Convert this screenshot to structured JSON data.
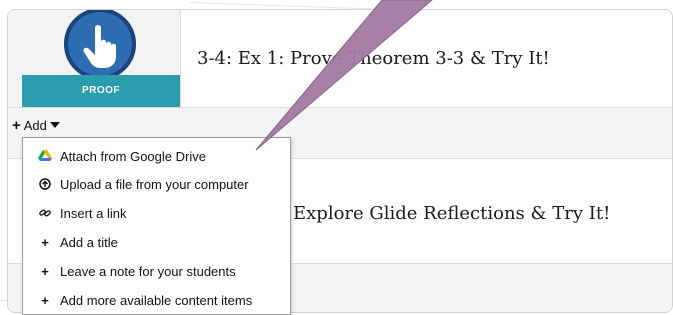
{
  "lesson1": {
    "badge_label": "PROOF",
    "title": "3-4: Ex 1: Prove Theorem 3-3 & Try It!"
  },
  "add_menu": {
    "toggle_label": "Add",
    "items": [
      {
        "icon": "google-drive-icon",
        "label": "Attach from Google Drive"
      },
      {
        "icon": "upload-icon",
        "label": "Upload a file from your computer"
      },
      {
        "icon": "link-icon",
        "label": "Insert a link"
      },
      {
        "icon": "plus-icon",
        "label": "Add a title"
      },
      {
        "icon": "plus-icon",
        "label": "Leave a note for your students"
      },
      {
        "icon": "plus-icon",
        "label": "Add more available content items"
      }
    ]
  },
  "lesson2": {
    "title": "Explore Glide Reflections & Try It!"
  },
  "colors": {
    "badge_band": "#2a9eaf",
    "badge_circle": "#2f6db3",
    "pointer_arrow": "#a47aa3"
  }
}
